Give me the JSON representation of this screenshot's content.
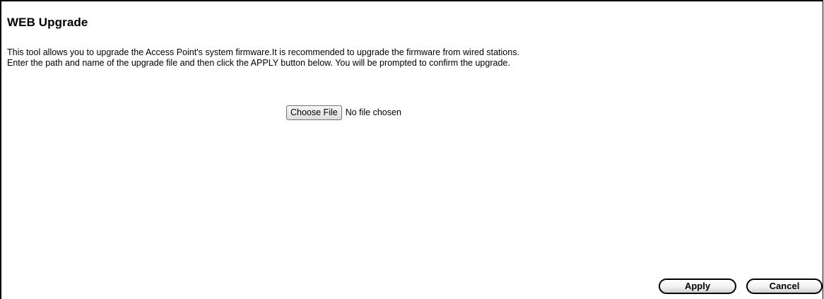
{
  "page": {
    "title": "WEB Upgrade",
    "description_line1": "This tool allows you to upgrade the Access Point's system firmware.It is recommended to upgrade the firmware from wired stations.",
    "description_line2": "Enter the path and name of the upgrade file and then click the APPLY button below. You will be prompted to confirm the upgrade."
  },
  "file_input": {
    "button_label": "Choose File",
    "status": "No file chosen"
  },
  "actions": {
    "apply_label": "Apply",
    "cancel_label": "Cancel"
  }
}
